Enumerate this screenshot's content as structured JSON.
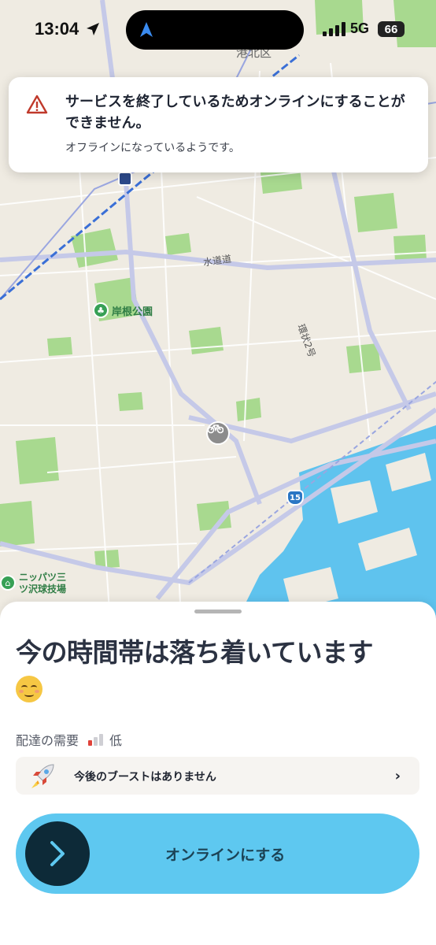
{
  "status_bar": {
    "time": "13:04",
    "network": "5G",
    "battery": "66"
  },
  "map": {
    "labels": {
      "ward": "港北区",
      "park": "岸根公園",
      "road_water": "水道道",
      "road_ring": "環状2号",
      "stadium": "ニッパツ三ツ沢球技場",
      "route_number": "15"
    },
    "colors": {
      "land": "#efebe2",
      "water": "#5fc3ee",
      "park": "#a8d98f",
      "major_road": "#c9cde6"
    }
  },
  "alert": {
    "icon": "warning-triangle-icon",
    "title": "サービスを終了しているためオンラインにすることができません。",
    "message": "オフラインになっているようです。"
  },
  "sheet": {
    "headline": "今の時間帯は落ち着いています",
    "headline_emoji": "relieved-face-icon",
    "demand_label": "配達の需要",
    "demand_level": "低",
    "demand_bars_active": 1,
    "demand_bars_total": 3,
    "boost_label": "今後のブーストはありません",
    "go_online_label": "オンラインにする"
  },
  "colors": {
    "go_online_bg": "#5ec8f0",
    "go_online_knob": "#0d2a38",
    "alert_icon": "#c0392b",
    "demand_active": "#e0433a"
  }
}
